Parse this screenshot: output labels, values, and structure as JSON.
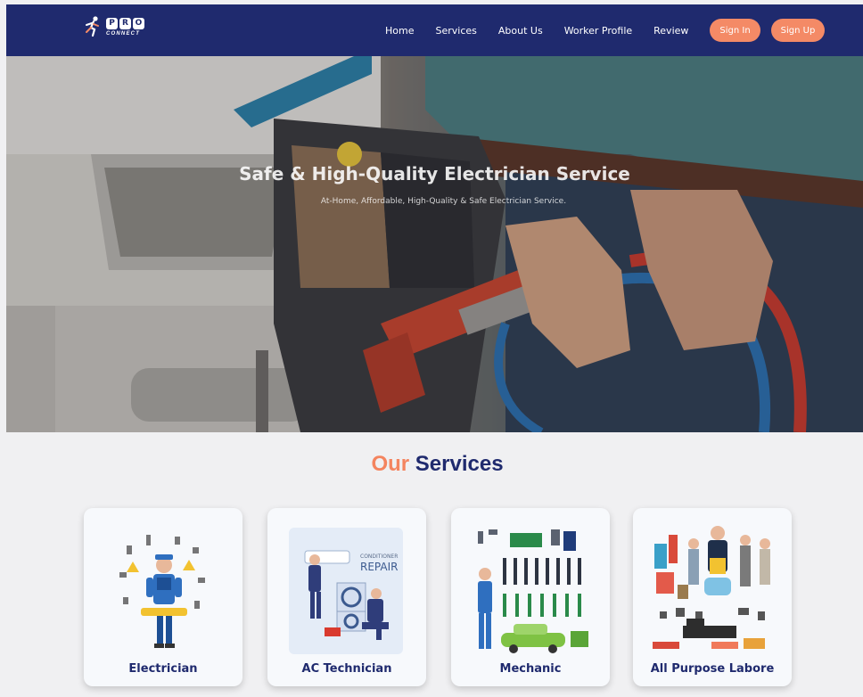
{
  "brand": {
    "logo_letters": [
      "P",
      "R",
      "O"
    ],
    "logo_sub": "CONNECT"
  },
  "nav": {
    "links": [
      "Home",
      "Services",
      "About Us",
      "Worker Profile",
      "Review"
    ],
    "signin_label": "Sign In",
    "signup_label": "Sign Up"
  },
  "hero": {
    "title": "Safe & High-Quality Electrician Service",
    "subtitle": "At-Home, Affordable, High-Quality & Safe Electrician Service."
  },
  "services": {
    "title_accent": "Our",
    "title_main": "Services",
    "cards": [
      {
        "label": "Electrician",
        "illustration_icon": "electrician-illustration-icon"
      },
      {
        "label": "AC Technician",
        "illustration_icon": "ac-repair-illustration-icon",
        "badge_small": "CONDITIONER",
        "badge_big": "REPAIR"
      },
      {
        "label": "Mechanic",
        "illustration_icon": "mechanic-tools-illustration-icon"
      },
      {
        "label": "All Purpose Labore",
        "illustration_icon": "labour-workers-illustration-icon"
      }
    ]
  },
  "colors": {
    "navbar": "#1f2a6e",
    "accent": "#f48a66",
    "title_main": "#1f2a6e"
  }
}
